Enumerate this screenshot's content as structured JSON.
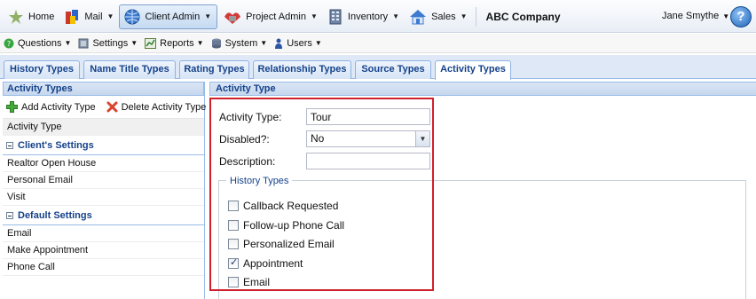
{
  "top_nav": {
    "items": [
      {
        "label": "Home",
        "icon": "home-icon"
      },
      {
        "label": "Mail",
        "icon": "mail-icon"
      },
      {
        "label": "Client Admin",
        "icon": "globe-icon"
      },
      {
        "label": "Project Admin",
        "icon": "project-icon"
      },
      {
        "label": "Inventory",
        "icon": "building-icon"
      },
      {
        "label": "Sales",
        "icon": "house-icon"
      }
    ],
    "company": "ABC Company",
    "user": "Jane Smythe",
    "help_label": "?"
  },
  "sub_nav": {
    "items": [
      {
        "label": "Questions",
        "icon": "question-icon"
      },
      {
        "label": "Settings",
        "icon": "settings-icon"
      },
      {
        "label": "Reports",
        "icon": "reports-icon"
      },
      {
        "label": "System",
        "icon": "system-icon"
      },
      {
        "label": "Users",
        "icon": "users-icon"
      }
    ]
  },
  "tabs": [
    {
      "label": "History Types"
    },
    {
      "label": "Name Title Types"
    },
    {
      "label": "Rating Types"
    },
    {
      "label": "Relationship Types"
    },
    {
      "label": "Source Types"
    },
    {
      "label": "Activity Types"
    }
  ],
  "left_panel": {
    "title": "Activity Types",
    "add_label": "Add Activity Type",
    "delete_label": "Delete Activity Type",
    "selected_item": "Activity Type",
    "groups": [
      {
        "title": "Client's Settings",
        "items": [
          "Realtor Open House",
          "Personal Email",
          "Visit"
        ]
      },
      {
        "title": "Default Settings",
        "items": [
          "Email",
          "Make Appointment",
          "Phone Call"
        ]
      }
    ]
  },
  "right_panel": {
    "title": "Activity Type",
    "fields": {
      "activity_type_label": "Activity Type:",
      "activity_type_value": "Tour",
      "disabled_label": "Disabled?:",
      "disabled_value": "No",
      "description_label": "Description:",
      "description_value": ""
    },
    "history_types_legend": "History Types",
    "history_types": [
      {
        "label": "Callback Requested",
        "checked": false
      },
      {
        "label": "Follow-up Phone Call",
        "checked": false
      },
      {
        "label": "Personalized Email",
        "checked": false
      },
      {
        "label": "Appointment",
        "checked": true
      },
      {
        "label": "Email",
        "checked": false
      }
    ]
  },
  "colors": {
    "highlight_border": "#d0202b",
    "header_text": "#15428b"
  }
}
